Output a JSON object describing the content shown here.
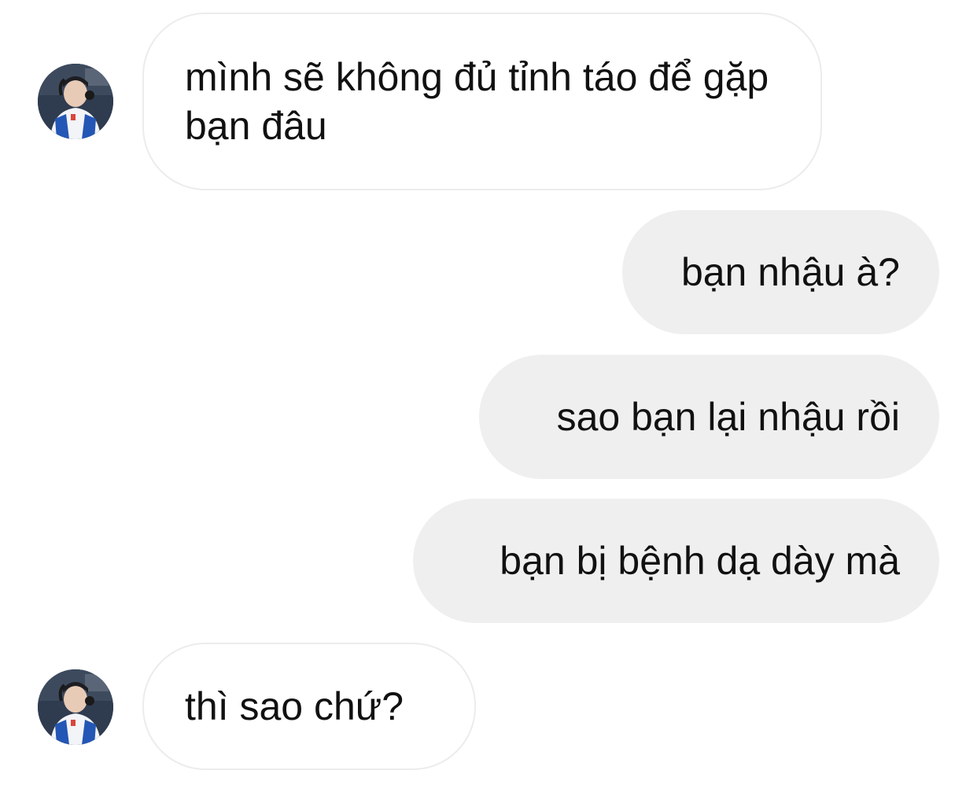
{
  "messages": [
    {
      "id": "m1",
      "direction": "incoming",
      "text": "mình sẽ không đủ tỉnh táo để gặp bạn đâu"
    },
    {
      "id": "m2",
      "direction": "outgoing",
      "text": "bạn nhậu à?"
    },
    {
      "id": "m3",
      "direction": "outgoing",
      "text": "sao bạn lại nhậu rồi"
    },
    {
      "id": "m4",
      "direction": "outgoing",
      "text": "bạn bị bệnh dạ dày mà"
    },
    {
      "id": "m5",
      "direction": "incoming",
      "text": "thì sao chứ?"
    }
  ],
  "colors": {
    "incoming_bubble": "#ffffff",
    "incoming_border": "#ececec",
    "outgoing_bubble": "#efefef",
    "text": "#111111"
  },
  "icons": {
    "avatar": "profile-photo-avatar"
  }
}
